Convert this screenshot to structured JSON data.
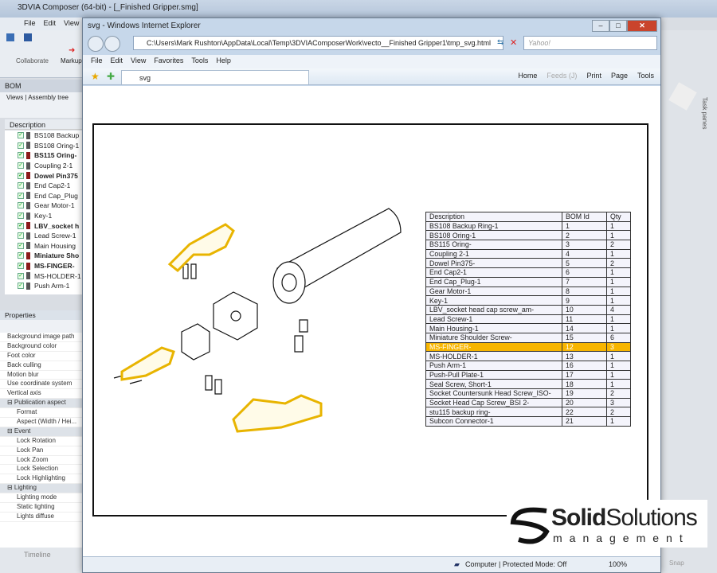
{
  "app": {
    "title": "3DVIA Composer (64-bit) - [_Finished Gripper.smg]",
    "menu": [
      "File",
      "Edit",
      "View"
    ],
    "ribbon": {
      "collaborate": "Collaborate",
      "markup": "Markup"
    },
    "bom": {
      "title": "BOM",
      "tabs": [
        "Views",
        "Assembly tree"
      ],
      "column": "Description",
      "items": [
        {
          "label": "BS108 Backup",
          "bold": false
        },
        {
          "label": "BS108 Oring-1",
          "bold": false
        },
        {
          "label": "BS115 Oring-",
          "bold": true
        },
        {
          "label": "Coupling 2-1",
          "bold": false
        },
        {
          "label": "Dowel Pin375",
          "bold": true
        },
        {
          "label": "End Cap2-1",
          "bold": false
        },
        {
          "label": "End Cap_Plug",
          "bold": false
        },
        {
          "label": "Gear Motor-1",
          "bold": false
        },
        {
          "label": "Key-1",
          "bold": false
        },
        {
          "label": "LBV_socket h",
          "bold": true
        },
        {
          "label": "Lead Screw-1",
          "bold": false
        },
        {
          "label": "Main Housing",
          "bold": false
        },
        {
          "label": "Miniature Sho",
          "bold": true
        },
        {
          "label": "MS-FINGER-",
          "bold": true
        },
        {
          "label": "MS-HOLDER-1",
          "bold": false
        },
        {
          "label": "Push Arm-1",
          "bold": false
        }
      ]
    },
    "properties": {
      "title": "Properties",
      "rows": [
        {
          "label": "Background image path",
          "type": "p"
        },
        {
          "label": "Background color",
          "type": "p"
        },
        {
          "label": "Foot color",
          "type": "p"
        },
        {
          "label": "Back culling",
          "type": "p"
        },
        {
          "label": "Motion blur",
          "type": "p"
        },
        {
          "label": "Use coordinate system",
          "type": "p"
        },
        {
          "label": "Vertical axis",
          "type": "p"
        },
        {
          "label": "⊟ Publication aspect",
          "type": "g"
        },
        {
          "label": "Format",
          "type": "s"
        },
        {
          "label": "Aspect (Width / Hei...",
          "type": "s"
        },
        {
          "label": "⊟ Event",
          "type": "g"
        },
        {
          "label": "Lock Rotation",
          "type": "s"
        },
        {
          "label": "Lock Pan",
          "type": "s"
        },
        {
          "label": "Lock Zoom",
          "type": "s"
        },
        {
          "label": "Lock Selection",
          "type": "s"
        },
        {
          "label": "Lock Highlighting",
          "type": "s"
        },
        {
          "label": "⊟ Lighting",
          "type": "g"
        },
        {
          "label": "Lighting mode",
          "type": "s"
        },
        {
          "label": "Static lighting",
          "type": "s"
        },
        {
          "label": "Lights diffuse",
          "type": "s"
        }
      ]
    },
    "timeline": "Timeline",
    "task_panes": "Task panes",
    "snap": "Snap"
  },
  "ie": {
    "title": "svg - Windows Internet Explorer",
    "address": "C:\\Users\\Mark Rushton\\AppData\\Local\\Temp\\3DVIAComposerWork\\vecto__Finished Gripper1\\tmp_svg.html",
    "search_placeholder": "Yahoo!",
    "menu": [
      "File",
      "Edit",
      "View",
      "Favorites",
      "Tools",
      "Help"
    ],
    "tab": "svg",
    "commands": [
      "Home",
      "Feeds (J)",
      "Print",
      "Page",
      "Tools"
    ],
    "status": "Computer | Protected Mode: Off",
    "zoom": "100%"
  },
  "bom_table": {
    "headers": [
      "Description",
      "BOM Id",
      "Qty"
    ],
    "highlight_color": "#f7b500",
    "rows": [
      [
        "BS108 Backup Ring-1",
        "1",
        "1"
      ],
      [
        "BS108 Oring-1",
        "2",
        "1"
      ],
      [
        "BS115 Oring-",
        "3",
        "2"
      ],
      [
        "Coupling 2-1",
        "4",
        "1"
      ],
      [
        "Dowel Pin375-",
        "5",
        "2"
      ],
      [
        "End Cap2-1",
        "6",
        "1"
      ],
      [
        "End Cap_Plug-1",
        "7",
        "1"
      ],
      [
        "Gear Motor-1",
        "8",
        "1"
      ],
      [
        "Key-1",
        "9",
        "1"
      ],
      [
        "LBV_socket head cap screw_am-",
        "10",
        "4"
      ],
      [
        "Lead Screw-1",
        "11",
        "1"
      ],
      [
        "Main Housing-1",
        "14",
        "1"
      ],
      [
        "Miniature Shoulder Screw-",
        "15",
        "6"
      ],
      [
        "MS-FINGER-",
        "12",
        "3"
      ],
      [
        "MS-HOLDER-1",
        "13",
        "1"
      ],
      [
        "Push Arm-1",
        "16",
        "1"
      ],
      [
        "Push-Pull Plate-1",
        "17",
        "1"
      ],
      [
        "Seal Screw, Short-1",
        "18",
        "1"
      ],
      [
        "Socket Countersunk Head Screw_ISO-",
        "19",
        "2"
      ],
      [
        "Socket Head Cap Screw_BSI 2-",
        "20",
        "3"
      ],
      [
        "stu115 backup ring-",
        "22",
        "2"
      ],
      [
        "Subcon Connector-1",
        "21",
        "1"
      ]
    ],
    "highlighted_row": 13
  },
  "logo": {
    "text1": "Solid",
    "text2": "Solutions",
    "text3": "management"
  }
}
